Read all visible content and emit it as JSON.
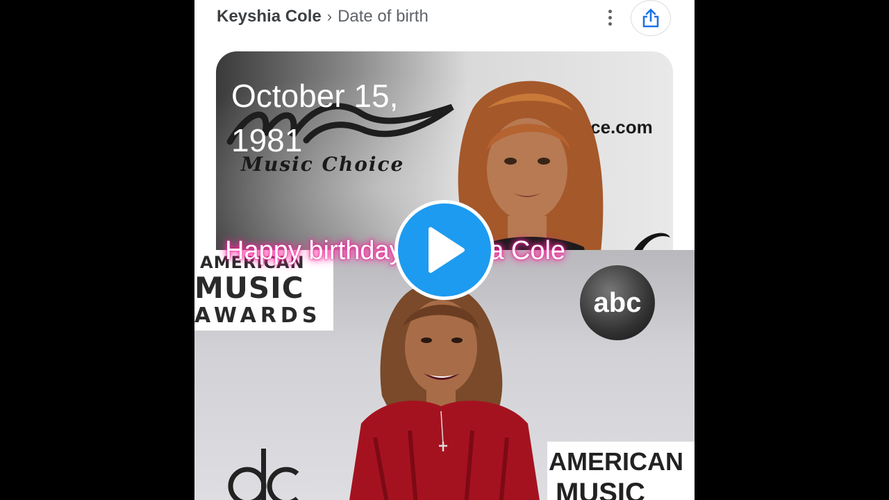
{
  "breadcrumb": {
    "subject": "Keyshia Cole",
    "separator": "›",
    "attribute": "Date of birth"
  },
  "answer": {
    "date": "October 15, 1981"
  },
  "card_image": {
    "logo_caption": "Music Choice",
    "domain_text": "oice.com"
  },
  "bottom_image": {
    "logo_line1": "AMERICAN",
    "logo_line2": "MUSIC",
    "logo_line3": "AWARDS",
    "network_logo": "abc",
    "logo2_line1": "AMERICAN",
    "logo2_line2": "MUSIC"
  },
  "overlay": {
    "caption": "Happy birthday Keyshia Cole"
  },
  "icons": {
    "menu": "more-vert-icon",
    "share": "share-icon",
    "play": "play-icon"
  },
  "colors": {
    "play_button": "#1d9bf0",
    "caption_glow": "#ff2aa0",
    "share_icon": "#1a73e8"
  }
}
